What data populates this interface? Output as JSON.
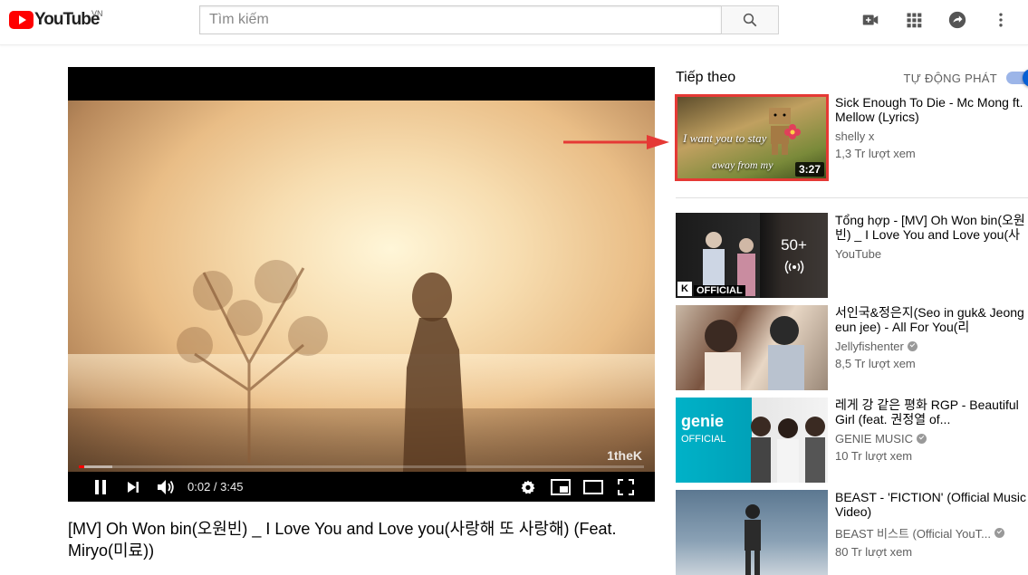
{
  "header": {
    "logo_text": "YouTube",
    "logo_country": "VN",
    "search_placeholder": "Tìm kiếm",
    "icons": [
      "search-icon",
      "video-camera-icon",
      "apps-grid-icon",
      "share-icon",
      "more-vert-icon"
    ]
  },
  "player": {
    "time": "0:02 / 3:45",
    "progress_fraction": 0.009,
    "watermark": "1theK",
    "icons": [
      "pause-icon",
      "next-icon",
      "volume-icon",
      "settings-icon",
      "miniplayer-icon",
      "theater-icon",
      "fullscreen-icon"
    ]
  },
  "video": {
    "title": "[MV] Oh Won bin(오원빈) _ I Love You and Love you(사랑해 또 사랑해) (Feat. Miryo(미료))"
  },
  "sidebar": {
    "up_next_label": "Tiếp theo",
    "autoplay_label": "TỰ ĐỘNG PHÁT",
    "autoplay_on": true,
    "items": [
      {
        "title": "Sick Enough To Die - Mc Mong ft. Mellow (Lyrics)",
        "channel": "shelly x",
        "views": "1,3 Tr lượt xem",
        "duration": "3:27",
        "caption1": "I want you to stay",
        "caption2": "away from my",
        "highlighted": true
      },
      {
        "title": "Tổng hợp - [MV] Oh Won bin(오원빈) _ I Love You and Love you(사랑",
        "channel": "YouTube",
        "playlist_count": "50+",
        "official_label": "OFFICIAL",
        "k_badge": "K"
      },
      {
        "title": "서인국&정은지(Seo in guk& Jeong eun jee) - All For You(리",
        "channel": "Jellyfishenter",
        "views": "8,5 Tr lượt xem",
        "verified": true
      },
      {
        "title": "레게 강 같은 평화 RGP - Beautiful Girl (feat. 권정열 of...",
        "channel": "GENIE MUSIC",
        "views": "10 Tr lượt xem",
        "verified": true,
        "thumb_logo": "genie",
        "thumb_sub": "OFFICIAL"
      },
      {
        "title": "BEAST - 'FICTION' (Official Music Video)",
        "channel": "BEAST 비스트 (Official YouT...",
        "views": "80 Tr lượt xem",
        "verified": true
      }
    ]
  },
  "colors": {
    "accent": "#065fd4",
    "brand": "#ff0000",
    "highlight_border": "#e53935",
    "arrow": "#e53935"
  }
}
